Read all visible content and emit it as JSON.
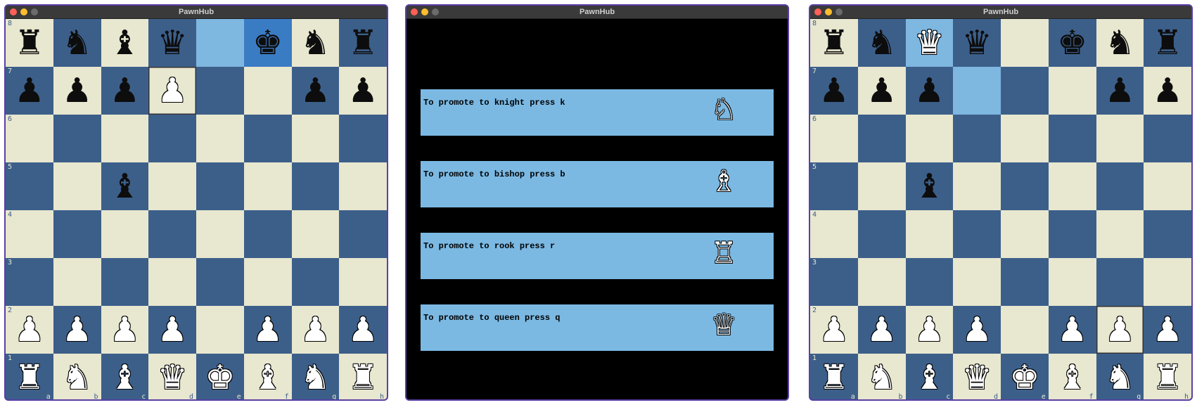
{
  "windows": {
    "left": {
      "title": "PawnHub"
    },
    "middle": {
      "title": "PawnHub"
    },
    "right": {
      "title": "PawnHub"
    }
  },
  "colors": {
    "light_square": "#e8e7cf",
    "dark_square": "#3c5f8a",
    "highlight": "#7eb7e0",
    "highlight_dark": "#3a7cc4",
    "promo_row": "#7bb9e3"
  },
  "board_left": [
    [
      "r",
      "n",
      "b",
      "q",
      "",
      "k",
      "n",
      "r"
    ],
    [
      "p",
      "p",
      "p",
      "P",
      "",
      "",
      "p",
      "p"
    ],
    [
      "",
      "",
      "",
      "",
      "",
      "",
      "",
      ""
    ],
    [
      "",
      "",
      "b",
      "",
      "",
      "",
      "",
      ""
    ],
    [
      "",
      "",
      "",
      "",
      "",
      "",
      "",
      ""
    ],
    [
      "",
      "",
      "",
      "",
      "",
      "",
      "",
      ""
    ],
    [
      "P",
      "P",
      "P",
      "P",
      "",
      "P",
      "P",
      "P"
    ],
    [
      "R",
      "N",
      "B",
      "Q",
      "K",
      "B",
      "N",
      "R"
    ]
  ],
  "board_left_highlights": {
    "e8": "hl",
    "f8": "hl-dark",
    "d7": "outline"
  },
  "board_right": [
    [
      "r",
      "n",
      "Q",
      "q",
      "",
      "k",
      "n",
      "r"
    ],
    [
      "p",
      "p",
      "p",
      "",
      "",
      "",
      "p",
      "p"
    ],
    [
      "",
      "",
      "",
      "",
      "",
      "",
      "",
      ""
    ],
    [
      "",
      "",
      "b",
      "",
      "",
      "",
      "",
      ""
    ],
    [
      "",
      "",
      "",
      "",
      "",
      "",
      "",
      ""
    ],
    [
      "",
      "",
      "",
      "",
      "",
      "",
      "",
      ""
    ],
    [
      "P",
      "P",
      "P",
      "P",
      "",
      "P",
      "P",
      "P"
    ],
    [
      "R",
      "N",
      "B",
      "Q",
      "K",
      "B",
      "N",
      "R"
    ]
  ],
  "board_right_highlights": {
    "c8": "hl",
    "d7": "hl",
    "g2": "outline"
  },
  "ranks": [
    "8",
    "7",
    "6",
    "5",
    "4",
    "3",
    "2",
    "1"
  ],
  "files": [
    "a",
    "b",
    "c",
    "d",
    "e",
    "f",
    "g",
    "h"
  ],
  "promotion": [
    {
      "text": "To promote to knight press k",
      "icon": "white-knight-icon",
      "glyph": "♘"
    },
    {
      "text": "To promote to bishop press b",
      "icon": "white-bishop-icon",
      "glyph": "♗"
    },
    {
      "text": "To promote to rook press r",
      "icon": "white-rook-icon",
      "glyph": "♖"
    },
    {
      "text": "To promote to queen press q",
      "icon": "white-queen-icon",
      "glyph": "♕"
    }
  ]
}
